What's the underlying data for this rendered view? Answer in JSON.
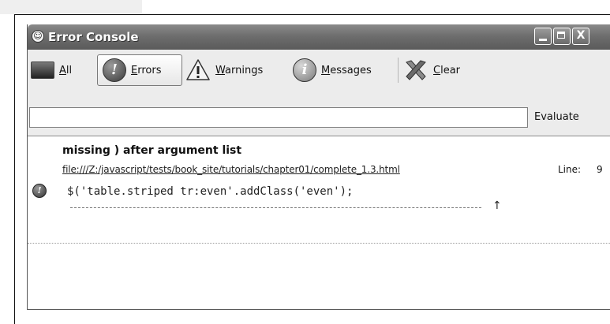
{
  "window": {
    "title": "Error Console",
    "app_icon": "firefox-icon",
    "controls": {
      "minimize": "minimize-icon",
      "maximize": "maximize-icon",
      "close_glyph": "X"
    }
  },
  "toolbar": {
    "all": {
      "label_underlined": "A",
      "label_rest": "ll",
      "icon": "all-messages-icon"
    },
    "errors": {
      "label_underlined": "E",
      "label_rest": "rrors",
      "icon": "error-icon",
      "selected": true
    },
    "warnings": {
      "label_underlined": "W",
      "label_rest": "arnings",
      "icon": "warning-icon"
    },
    "messages": {
      "label_underlined": "M",
      "label_rest": "essages",
      "icon": "info-icon"
    },
    "clear": {
      "label_underlined": "C",
      "label_rest": "lear",
      "icon": "clear-x-icon"
    }
  },
  "evaluate": {
    "input_value": "",
    "button_label": "Evaluate"
  },
  "errors": [
    {
      "icon": "error-icon",
      "glyph": "!",
      "message": "missing ) after argument list",
      "file": "file:///Z:/javascript/tests/book_site/tutorials/chapter01/complete_1.3.html",
      "line_label": "Line:",
      "line_number": "9",
      "code": "$('table.striped tr:even'.addClass('even');",
      "caret": "↑"
    }
  ]
}
